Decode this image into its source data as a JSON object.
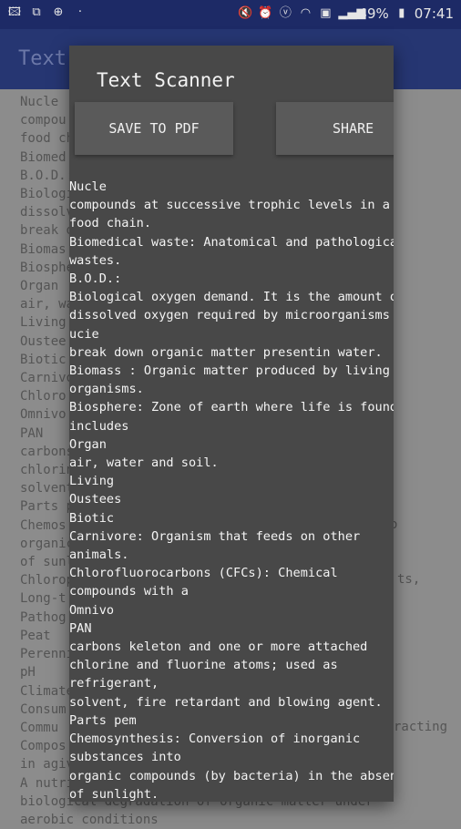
{
  "status_bar": {
    "left_icons": [
      "image-icon",
      "cast-icon",
      "globe-icon"
    ],
    "dot": "·",
    "battery": "49%",
    "time": "07:41"
  },
  "app_bar": {
    "title": "Text S"
  },
  "background_lines": [
    "Nucle",
    "compou",
    "food ch",
    "Biomed",
    "B.O.D.:",
    "Biologi",
    "dissolv",
    "break d",
    "Biomas",
    "Biosphe",
    "Organ",
    "air, wat",
    "Living",
    "Oustee",
    "Biotic",
    "Carnivo",
    "Chloro",
    "Omnivo",
    "PAN",
    "carbons",
    "chlorin",
    "solvent",
    "Parts p",
    "Chemos",
    "organic",
    "of sunli",
    "Chlorop",
    "Long-t",
    "Pathog",
    "Peat",
    "Perenni",
    "pH",
    "Climate",
    "Consum",
    "Commu",
    "Compos",
    "in agive",
    "A nutri",
    "biological degradation of organic matter under",
    "aerobic conditions"
  ],
  "background_right": [
    "o",
    "ts,",
    "racting"
  ],
  "dialog": {
    "title": "Text Scanner",
    "save_button": "SAVE TO PDF",
    "share_button": "SHARE",
    "lines": [
      "Nucle",
      "compounds at successive trophic levels in a",
      "food chain.",
      "Biomedical waste: Anatomical and pathological",
      "wastes.",
      "B.O.D.:",
      "Biological oxygen demand. It is the amount of|",
      "dissolved oxygen required by microorganisms to",
      "ucie",
      "break down organic matter presentin water.",
      "Biomass : Organic matter produced by living",
      "organisms.",
      "Biosphere: Zone of earth where life is found. It",
      "includes",
      "Organ",
      "air, water and soil.",
      "Living",
      "Oustees",
      "Biotic",
      "Carnivore: Organism that feeds on other",
      "animals.",
      "Chlorofluorocarbons (CFCs): Chemical",
      "compounds with a",
      "Omnivo",
      "PAN",
      "carbons keleton and one or more attached",
      "chlorine and fluorine atoms; used as",
      "refrigerant,",
      "solvent, fire retardant and blowing agent.",
      "Parts pem",
      "Chemosynthesis: Conversion of inorganic",
      "substances into",
      "organic compounds (by bacteria) in the absence",
      "of sunlight."
    ]
  }
}
